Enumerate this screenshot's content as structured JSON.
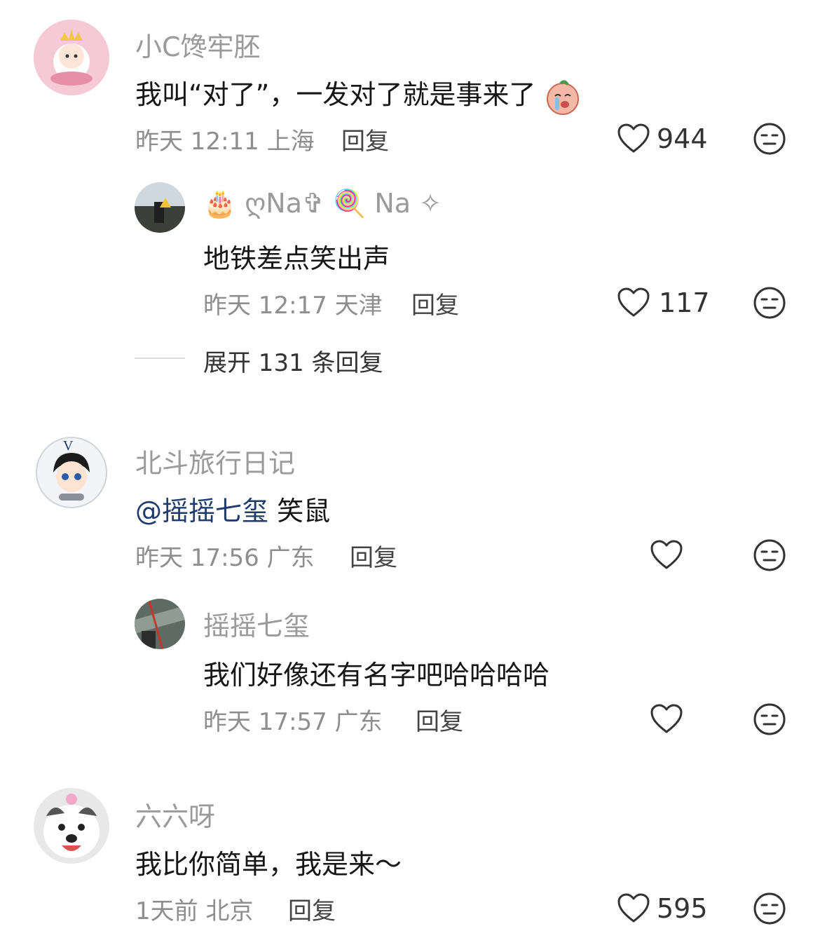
{
  "comments": [
    {
      "name": "小C馋牢胚",
      "text": "我叫“对了”，一发对了就是事来了",
      "time": "昨天 12:11",
      "location": "上海",
      "reply": "回复",
      "likes": "944",
      "replies": [
        {
          "name_prefix_emoji": "🎂",
          "name": "ღNa✞",
          "name_emoji": "🍭",
          "name_suffix": "Na ✧",
          "text": "地铁差点笑出声",
          "time": "昨天 12:17",
          "location": "天津",
          "reply": "回复",
          "likes": "117"
        }
      ],
      "expand": "展开 131 条回复"
    },
    {
      "name": "北斗旅行日记",
      "mention": "@摇摇七玺",
      "text": "笑鼠",
      "time": "昨天 17:56",
      "location": "广东",
      "reply": "回复",
      "likes": "",
      "replies": [
        {
          "name": "摇摇七玺",
          "text": "我们好像还有名字吧哈哈哈哈",
          "time": "昨天 17:57",
          "location": "广东",
          "reply": "回复",
          "likes": ""
        }
      ]
    },
    {
      "name": "六六呀",
      "text": "我比你简单，我是来～",
      "time": "1天前",
      "location": "北京",
      "reply": "回复",
      "likes": "595"
    }
  ],
  "colors": {
    "mention": "#1f3b6e",
    "meta": "#8e8e8e",
    "name": "#9a9a9a"
  },
  "icons": {
    "like": "heart-outline-icon",
    "dislike": "neutral-face-icon"
  }
}
